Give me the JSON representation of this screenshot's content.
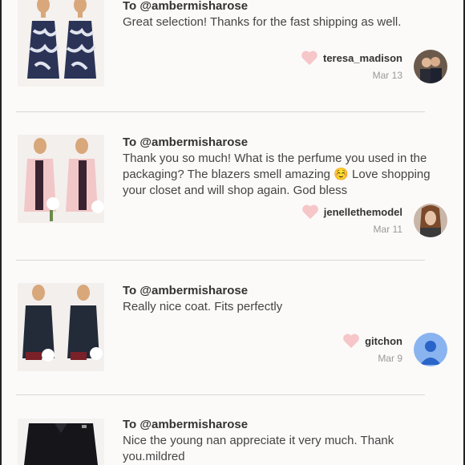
{
  "reviews": [
    {
      "to": "To @ambermisharose",
      "message": "Great selection! Thanks for the fast shipping as well.",
      "username": "teresa_madison",
      "date": "Mar 13",
      "icons": {
        "like": "heart-icon",
        "thumb": "dress-photo",
        "avatar": "user-photo"
      }
    },
    {
      "to": "To @ambermisharose",
      "message": "Thank you so much! What is the perfume you used in the packaging? The blazers smell amazing ☺️ Love shopping your closet and will shop again. God bless",
      "username": "jenellethemodel",
      "date": "Mar 11",
      "icons": {
        "like": "heart-icon",
        "thumb": "pink-blazer-photo",
        "avatar": "user-photo"
      }
    },
    {
      "to": "To @ambermisharose",
      "message": "Really nice coat. Fits perfectly",
      "username": "gitchon",
      "date": "Mar 9",
      "icons": {
        "like": "heart-icon",
        "thumb": "navy-coat-photo",
        "avatar": "default-user-icon"
      }
    },
    {
      "to": "To @ambermisharose",
      "message": "Nice the young nan appreciate it very much. Thank you.mildred",
      "icons": {
        "thumb": "black-shirt-photo"
      }
    }
  ],
  "colors": {
    "heart": "#f6c6c8",
    "divider": "#d9d6d4",
    "default_avatar_bg": "#8ab4f0",
    "default_avatar_fg": "#2a64c8"
  }
}
